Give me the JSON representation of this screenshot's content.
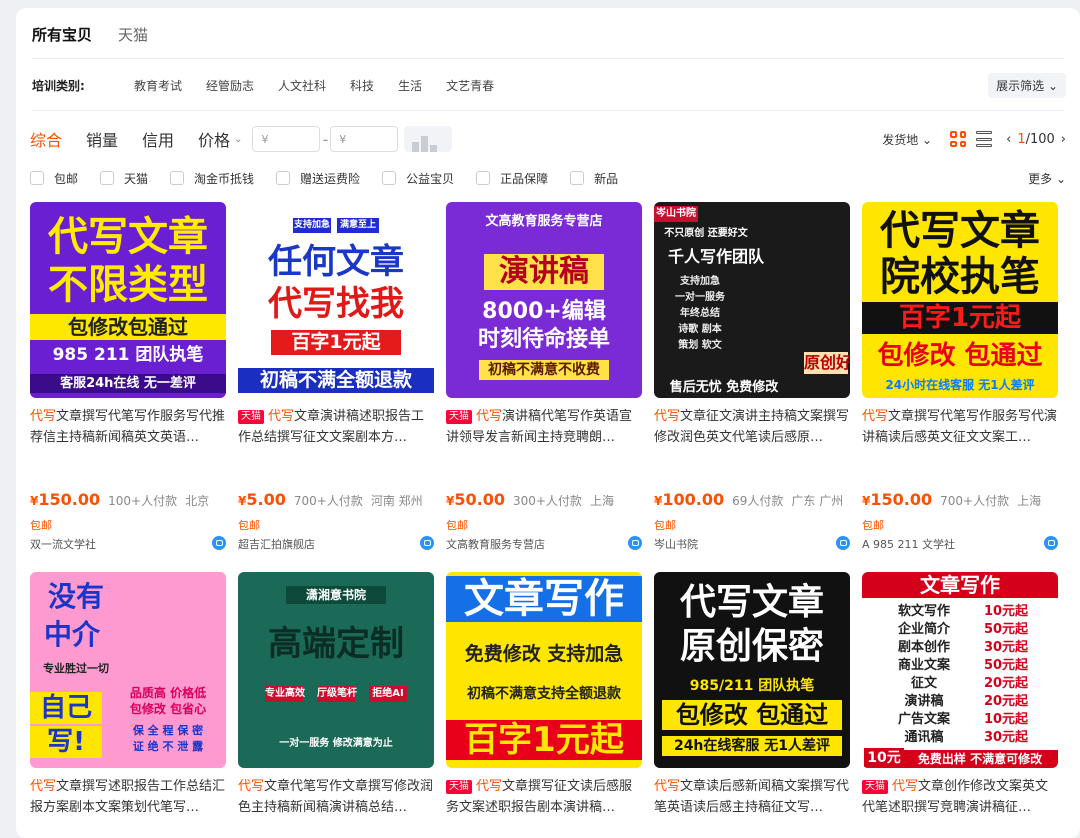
{
  "tabs": [
    "所有宝贝",
    "天猫"
  ],
  "category": {
    "label": "培训类别:",
    "items": [
      "教育考试",
      "经管励志",
      "人文社科",
      "科技",
      "生活",
      "文艺青春"
    ],
    "filter": "展示筛选 ⌄"
  },
  "sort": {
    "items": [
      "综合",
      "销量",
      "信用"
    ],
    "price_label": "价格",
    "price_min_placeholder": "¥",
    "price_max_placeholder": "¥",
    "ship_from": "发货地 ⌄",
    "page_current": "1",
    "page_total": "/100"
  },
  "filters": {
    "items": [
      "包邮",
      "天猫",
      "淘金币抵钱",
      "赠送运费险",
      "公益宝贝",
      "正品保障",
      "新品"
    ],
    "more": "更多 ⌄"
  },
  "products": [
    {
      "brand": "代写",
      "tmall": false,
      "title": "文章撰写代笔写作服务写代推荐信主持稿新闻稿英文英语…",
      "price_symbol": "¥",
      "price": "150.00",
      "sold": "100+人付款",
      "loc": "北京",
      "ship": "包邮",
      "shop": "双一流文学社",
      "img": {
        "bg": "#6a1fd1",
        "lines": [
          "代写文章",
          "不限类型",
          "包修改包通过",
          "985 211 团队执笔",
          "客服24h在线   无一差评"
        ]
      }
    },
    {
      "brand": "代写",
      "tmall": true,
      "title": "文章演讲稿述职报告工作总结撰写征文文案剧本方…",
      "price_symbol": "¥",
      "price": "5.00",
      "sold": "700+人付款",
      "loc": "河南 郑州",
      "ship": "包邮",
      "shop": "超吉汇拍旗舰店",
      "img": {
        "bg": "#ffffff",
        "lines": [
          "支持加急",
          "满意至上",
          "任何文章",
          "代写找我",
          "百字1元起",
          "初稿不满全额退款"
        ]
      }
    },
    {
      "brand": "代写",
      "tmall": true,
      "title": "演讲稿代笔写作英语宣讲领导发言新闻主持竞聘朗…",
      "price_symbol": "¥",
      "price": "50.00",
      "sold": "300+人付款",
      "loc": "上海",
      "ship": "包邮",
      "shop": "文高教育服务专营店",
      "img": {
        "bg": "#7a2bd6",
        "lines": [
          "文高教育服务专营店",
          "演讲稿",
          "8000+编辑",
          "时刻待命接单",
          "初稿不满意不收费"
        ]
      }
    },
    {
      "brand": "代写",
      "tmall": false,
      "title": "文章征文演讲主持稿文案撰写修改润色英文代笔读后感原…",
      "price_symbol": "¥",
      "price": "100.00",
      "sold": "69人付款",
      "loc": "广东 广州",
      "ship": "包邮",
      "shop": "岑山书院",
      "img": {
        "bg": "#1a1a1a",
        "lines": [
          "岑山书院",
          "不只原创 还要好文",
          "千人写作团队",
          "支持加急",
          "一对一服务",
          "年终总结",
          "诗歌 剧本",
          "策划 软文",
          "售后无忧 免费修改",
          "原创好作"
        ]
      }
    },
    {
      "brand": "代写",
      "tmall": false,
      "title": "文章撰写代笔写作服务写代演讲稿读后感英文征文文案工…",
      "price_symbol": "¥",
      "price": "150.00",
      "sold": "700+人付款",
      "loc": "上海",
      "ship": "包邮",
      "shop": "A 985 211 文学社",
      "img": {
        "bg": "#ffe600",
        "lines": [
          "代写文章",
          "院校执笔",
          "百字1元起",
          "包修改 包通过",
          "24小时在线客服 无1人差评"
        ]
      }
    },
    {
      "brand": "代写",
      "tmall": false,
      "title": "文章撰写述职报告工作总结汇报方案剧本文案策划代笔写…",
      "price_symbol": "",
      "price": "",
      "sold": "",
      "loc": "",
      "ship": "",
      "shop": "",
      "img": {
        "bg": "#ff9ad1",
        "lines": [
          "没有",
          "中介",
          "专业胜过一切",
          "自己",
          "写!",
          "品质高 价格低",
          "包修改 包省心",
          "保 全 程 保 密",
          "证 绝 不 泄 露"
        ]
      }
    },
    {
      "brand": "代写",
      "tmall": false,
      "title": "文章代笔写作文章撰写修改润色主持稿新闻稿演讲稿总结…",
      "price_symbol": "",
      "price": "",
      "sold": "",
      "loc": "",
      "ship": "",
      "shop": "",
      "img": {
        "bg": "#1b6a57",
        "lines": [
          "潇湘意书院",
          "高端定制",
          "专业高效",
          "厅级笔杆",
          "拒绝AI",
          "一对一服务 修改满意为止"
        ]
      }
    },
    {
      "brand": "代写",
      "tmall": true,
      "title": "文章撰写征文读后感服务文案述职报告剧本演讲稿…",
      "price_symbol": "",
      "price": "",
      "sold": "",
      "loc": "",
      "ship": "",
      "shop": "",
      "img": {
        "bg": "#ffe600",
        "lines": [
          "文章写作",
          "免费修改 支持加急",
          "初稿不满意支持全额退款",
          "百字1元起"
        ]
      }
    },
    {
      "brand": "代写",
      "tmall": false,
      "title": "文章读后感新闻稿文案撰写代笔英语读后感主持稿征文写…",
      "price_symbol": "",
      "price": "",
      "sold": "",
      "loc": "",
      "ship": "",
      "shop": "",
      "img": {
        "bg": "#111111",
        "lines": [
          "代写文章",
          "原创保密",
          "985/211 团队执笔",
          "包修改 包通过",
          "24h在线客服 无1人差评"
        ]
      }
    },
    {
      "brand": "代写",
      "tmall": true,
      "title": "文章创作修改文案英文代笔述职撰写竞聘演讲稿征…",
      "price_symbol": "",
      "price": "",
      "sold": "",
      "loc": "",
      "ship": "",
      "shop": "",
      "img": {
        "bg": "#ffffff",
        "lines": [
          "文章写作",
          "软文写作",
          "10元起",
          "企业简介",
          "50元起",
          "剧本创作",
          "30元起",
          "商业文案",
          "50元起",
          "征文",
          "20元起",
          "演讲稿",
          "20元起",
          "广告文案",
          "10元起",
          "通讯稿",
          "30元起",
          "10元",
          "免费出样 不满意可修改"
        ]
      }
    }
  ]
}
